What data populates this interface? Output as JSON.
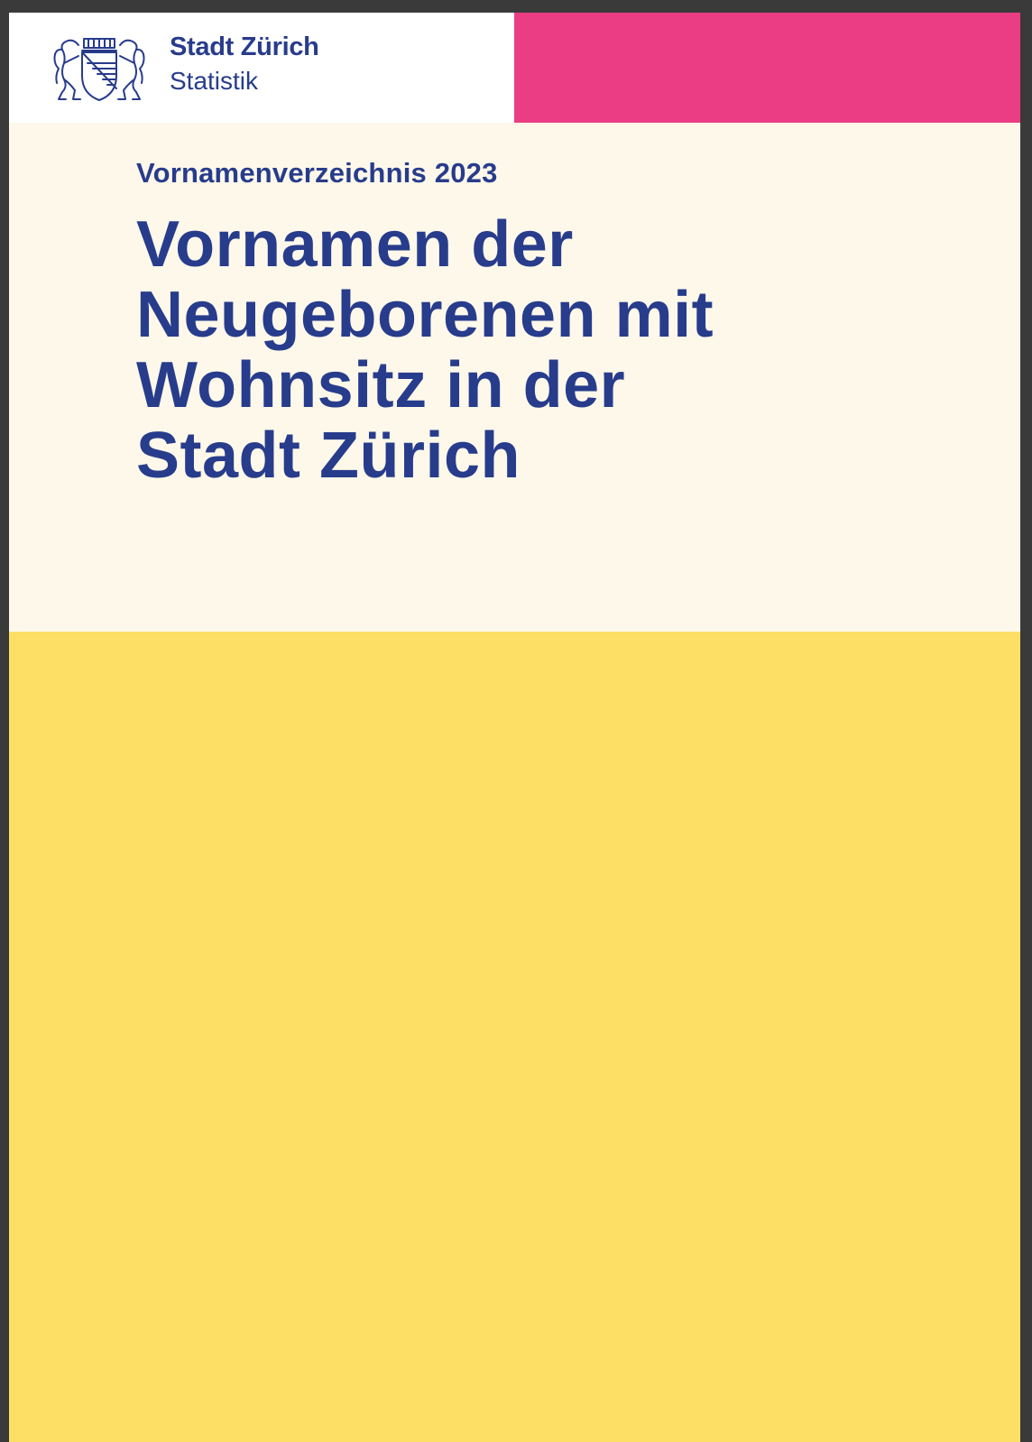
{
  "header": {
    "brand_name": "Stadt Zürich",
    "brand_unit": "Statistik",
    "logo_icon": "zurich-coat-of-arms-icon"
  },
  "cover": {
    "kicker": "Vornamenverzeichnis 2023",
    "title_lines": [
      "Vornamen der",
      "Neugeborenen mit",
      "Wohnsitz in der",
      "Stadt Zürich"
    ]
  },
  "colors": {
    "brand_blue": "#283c8c",
    "accent_pink": "#ea3d84",
    "cover_cream": "#fdf8e9",
    "cover_yellow": "#fddf66"
  }
}
